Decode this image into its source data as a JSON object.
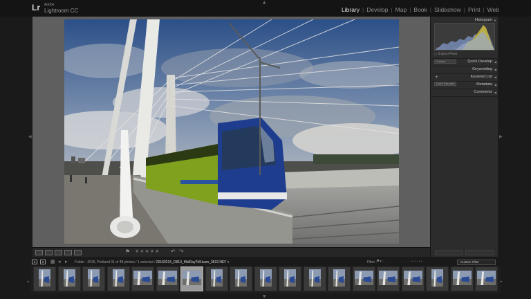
{
  "app": {
    "logo": "Lr",
    "brand_line1": "Adobe",
    "brand_line2": "Lightroom CC"
  },
  "modules": [
    {
      "label": "Library",
      "active": true
    },
    {
      "label": "Develop",
      "active": false
    },
    {
      "label": "Map",
      "active": false
    },
    {
      "label": "Book",
      "active": false
    },
    {
      "label": "Slideshow",
      "active": false
    },
    {
      "label": "Print",
      "active": false
    },
    {
      "label": "Web",
      "active": false
    }
  ],
  "right_panel": {
    "histogram": "Histogram",
    "histogram_info": [
      "ISO 100",
      "16 mm",
      "f / 11",
      "1/₁₂₅ sec"
    ],
    "original_photo": "Original Photo",
    "quick_develop": "Quick Develop",
    "quick_develop_select": "Custom",
    "keywording": "Keywording",
    "keyword_list": "Keyword List",
    "metadata": "Metadata",
    "metadata_select": "Quick Describe",
    "comments": "Comments"
  },
  "filmstrip_header": {
    "monitor1": "1",
    "monitor2": "2",
    "path": "Folder : 2016, Portland",
    "count": "31 of 48 photos / 1 selected /",
    "filename": "20160215_D810_MidDayTriKicam_3822.NEF",
    "filter_label": "Filter :",
    "custom_filter": "Custom Filter"
  },
  "colors": {
    "accent_active": "#e4e4e4",
    "panel_bg": "#2c2c2c",
    "viewer_bg": "#5f5f5f",
    "tram_blue": "#1f3d8f",
    "tram_green": "#7fa11e"
  },
  "filmstrip": {
    "selected_index": 6,
    "thumbnails": [
      {
        "orientation": "portrait"
      },
      {
        "orientation": "portrait"
      },
      {
        "orientation": "portrait"
      },
      {
        "orientation": "portrait"
      },
      {
        "orientation": "landscape"
      },
      {
        "orientation": "landscape"
      },
      {
        "orientation": "landscape"
      },
      {
        "orientation": "portrait"
      },
      {
        "orientation": "portrait"
      },
      {
        "orientation": "portrait"
      },
      {
        "orientation": "portrait"
      },
      {
        "orientation": "portrait"
      },
      {
        "orientation": "portrait"
      },
      {
        "orientation": "landscape"
      },
      {
        "orientation": "landscape"
      },
      {
        "orientation": "landscape"
      },
      {
        "orientation": "portrait"
      },
      {
        "orientation": "landscape"
      },
      {
        "orientation": "landscape"
      }
    ]
  }
}
